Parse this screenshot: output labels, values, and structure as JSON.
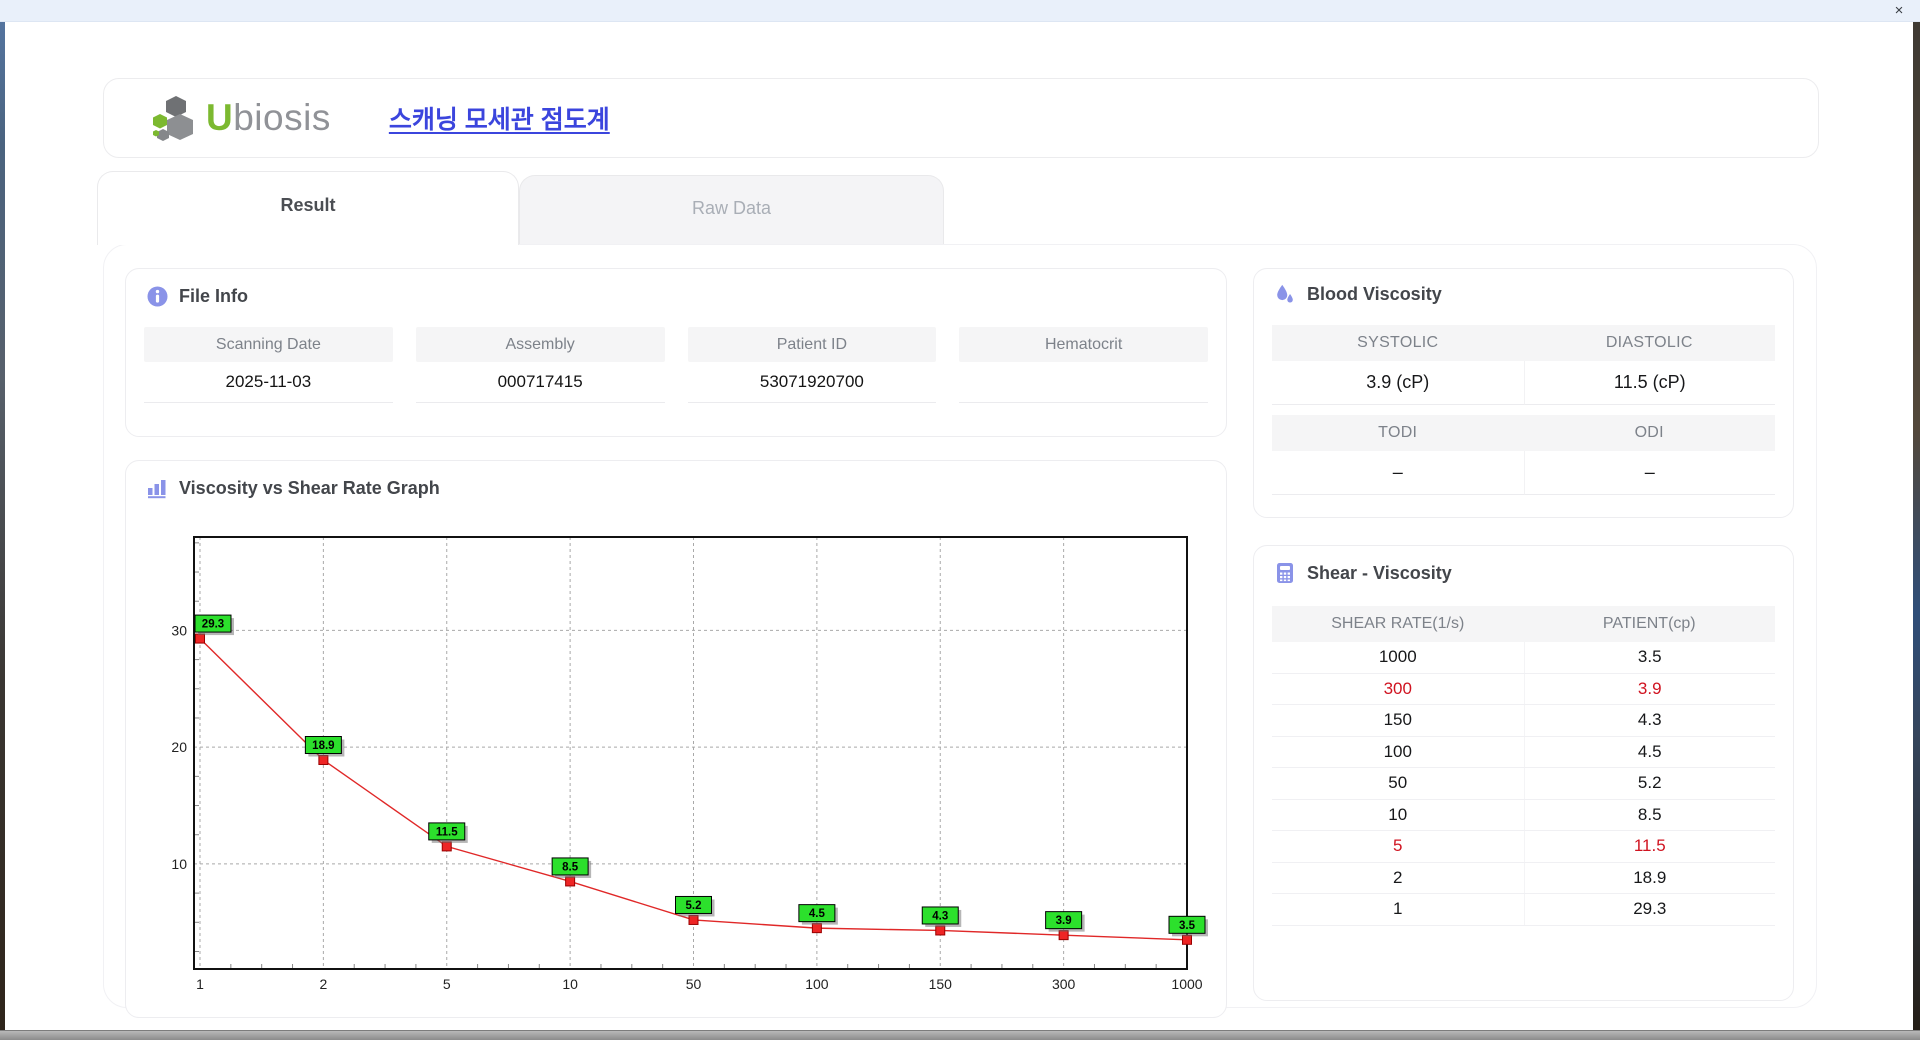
{
  "window": {
    "close_label": "×"
  },
  "header": {
    "logo_first_letter": "U",
    "logo_rest": "biosis",
    "app_title_korean": "스캐닝 모세관 점도계"
  },
  "tabs": [
    {
      "label": "Result",
      "active": true
    },
    {
      "label": "Raw Data",
      "active": false
    }
  ],
  "file_info": {
    "section_title": "File Info",
    "fields": [
      {
        "label": "Scanning Date",
        "value": "2025-11-03"
      },
      {
        "label": "Assembly",
        "value": "000717415"
      },
      {
        "label": "Patient ID",
        "value": "53071920700"
      },
      {
        "label": "Hematocrit",
        "value": ""
      }
    ]
  },
  "blood_viscosity": {
    "section_title": "Blood Viscosity",
    "metrics": [
      {
        "label": "SYSTOLIC",
        "value": "3.9 (cP)"
      },
      {
        "label": "DIASTOLIC",
        "value": "11.5 (cP)"
      },
      {
        "label": "TODI",
        "value": "–"
      },
      {
        "label": "ODI",
        "value": "–"
      }
    ]
  },
  "graph_section": {
    "section_title": "Viscosity vs Shear Rate Graph"
  },
  "chart_data": {
    "type": "line",
    "title": "Viscosity vs Shear Rate Graph",
    "xlabel": "",
    "ylabel": "",
    "x_tick_labels": [
      "1",
      "2",
      "5",
      "10",
      "50",
      "100",
      "150",
      "300",
      "1000"
    ],
    "x_axis_style": "categorical-log-like",
    "series": [
      {
        "name": "PATIENT",
        "values": [
          29.3,
          18.9,
          11.5,
          8.5,
          5.2,
          4.5,
          4.3,
          3.9,
          3.5
        ]
      }
    ],
    "point_labels": [
      "29.3",
      "18.9",
      "11.5",
      "8.5",
      "5.2",
      "4.5",
      "4.3",
      "3.9",
      "3.5"
    ],
    "yticks": [
      10,
      20,
      30
    ],
    "ylim": [
      1,
      38
    ],
    "grid": true,
    "grid_style": "dashed",
    "line_color": "#e02828",
    "marker_color": "#ee2525",
    "marker_edge": "#990000",
    "point_label_bg": "#2ce02c",
    "point_label_border": "#000000",
    "legend": "none"
  },
  "shear_table": {
    "section_title": "Shear - Viscosity",
    "columns": [
      "SHEAR RATE(1/s)",
      "PATIENT(cp)"
    ],
    "rows": [
      {
        "shear_rate": "1000",
        "patient": "3.5",
        "highlight": false
      },
      {
        "shear_rate": "300",
        "patient": "3.9",
        "highlight": true
      },
      {
        "shear_rate": "150",
        "patient": "4.3",
        "highlight": false
      },
      {
        "shear_rate": "100",
        "patient": "4.5",
        "highlight": false
      },
      {
        "shear_rate": "50",
        "patient": "5.2",
        "highlight": false
      },
      {
        "shear_rate": "10",
        "patient": "8.5",
        "highlight": false
      },
      {
        "shear_rate": "5",
        "patient": "11.5",
        "highlight": true
      },
      {
        "shear_rate": "2",
        "patient": "18.9",
        "highlight": false
      },
      {
        "shear_rate": "1",
        "patient": "29.3",
        "highlight": false
      }
    ]
  }
}
